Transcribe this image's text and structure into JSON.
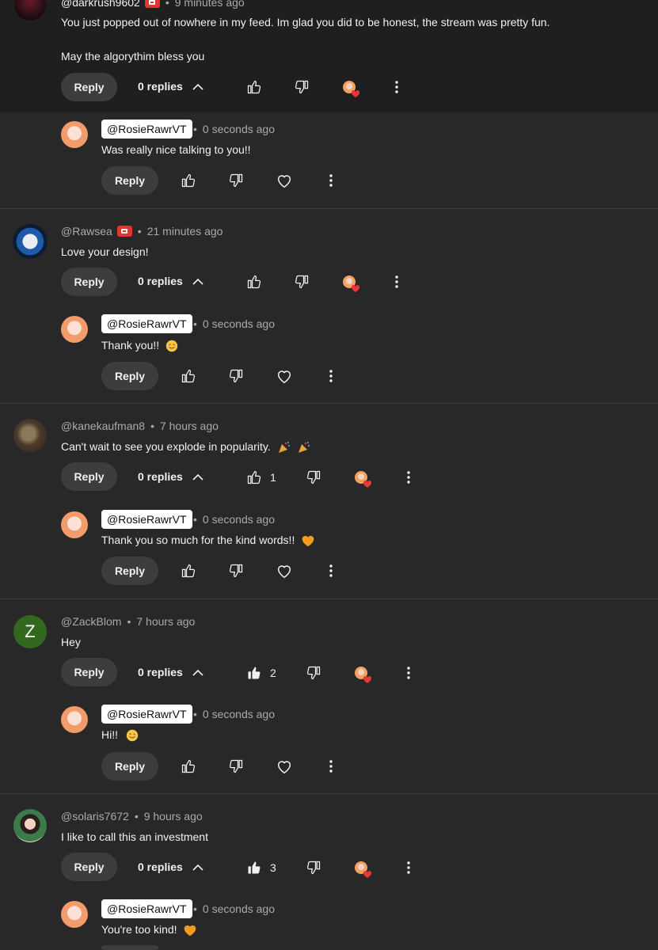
{
  "labels": {
    "reply": "Reply"
  },
  "colors": {
    "background": "#282828",
    "top_background": "#1f1f1f",
    "button_bg": "#3d3d3d",
    "text": "#f1f1f1",
    "meta": "#aaaaaa",
    "badge_red": "#e3342f",
    "heart_red": "#e53935",
    "orange_heart": "#f29b1d"
  },
  "threads": [
    {
      "author": "@darkrush9602",
      "time": "9 minutes ago",
      "verified_badge": true,
      "text_lines": [
        "You just popped out of nowhere in my feed. Im glad you did to be honest, the stream was pretty fun.",
        "May the algorythim bless you"
      ],
      "replies_label": "0 replies",
      "likes": "",
      "liked": false,
      "reply": {
        "author": "@RosieRawrVT",
        "time": "0 seconds ago",
        "text": "Was really nice talking to you!!",
        "emoji": ""
      }
    },
    {
      "author": "@Rawsea",
      "time": "21 minutes ago",
      "verified_badge": true,
      "text_lines": [
        "Love your design!"
      ],
      "replies_label": "0 replies",
      "likes": "",
      "liked": false,
      "reply": {
        "author": "@RosieRawrVT",
        "time": "0 seconds ago",
        "text": "Thank you!!",
        "emoji": "smiling-face"
      }
    },
    {
      "author": "@kanekaufman8",
      "time": "7 hours ago",
      "verified_badge": false,
      "text_lines": [
        "Can't wait to see you explode in popularity."
      ],
      "replies_label": "0 replies",
      "likes": "1",
      "liked": false,
      "reply": {
        "author": "@RosieRawrVT",
        "time": "0 seconds ago",
        "text": "Thank you so much for the kind words!!",
        "emoji": "orange-heart"
      }
    },
    {
      "author": "@ZackBlom",
      "time": "7 hours ago",
      "verified_badge": false,
      "avatar_letter": "Z",
      "text_lines": [
        "Hey"
      ],
      "replies_label": "0 replies",
      "likes": "2",
      "liked": true,
      "reply": {
        "author": "@RosieRawrVT",
        "time": "0 seconds ago",
        "text": "Hi!!",
        "emoji": "smiling-face"
      }
    },
    {
      "author": "@solaris7672",
      "time": "9 hours ago",
      "verified_badge": false,
      "text_lines": [
        "I like to call this an investment"
      ],
      "replies_label": "0 replies",
      "likes": "3",
      "liked": true,
      "reply": {
        "author": "@RosieRawrVT",
        "time": "0 seconds ago",
        "text": "You're too kind!",
        "emoji": "orange-heart"
      }
    }
  ]
}
